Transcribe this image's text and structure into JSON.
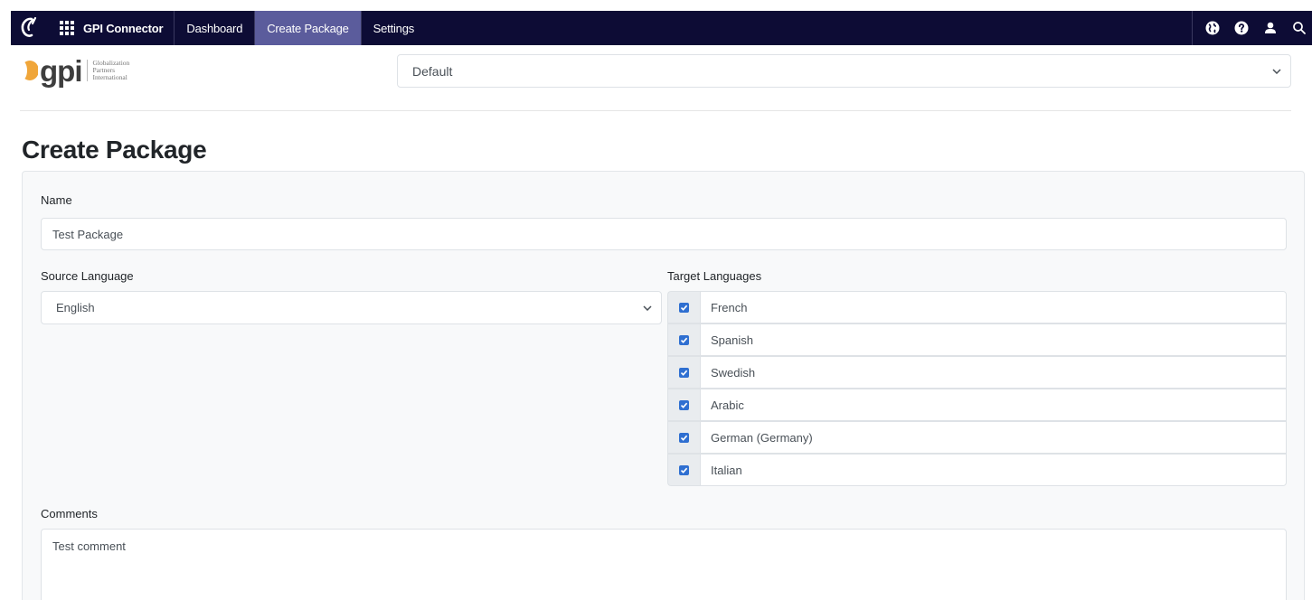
{
  "navbar": {
    "app_name": "GPI Connector",
    "items": [
      {
        "label": "Dashboard",
        "active": false
      },
      {
        "label": "Create Package",
        "active": true
      },
      {
        "label": "Settings",
        "active": false
      }
    ],
    "right_icons": [
      "globe-icon",
      "help-icon",
      "user-icon",
      "search-icon"
    ],
    "background_color": "#0d0c35",
    "active_color": "#5b5c9c"
  },
  "logo": {
    "text": "gpi",
    "subtitle_lines": [
      "Globalization",
      "Partners",
      "International"
    ]
  },
  "profile_select": {
    "value": "Default"
  },
  "page": {
    "title": "Create Package"
  },
  "form": {
    "name_label": "Name",
    "name_value": "Test Package",
    "source_label": "Source Language",
    "source_value": "English",
    "target_label": "Target Languages",
    "target_languages": [
      {
        "name": "French",
        "checked": true
      },
      {
        "name": "Spanish",
        "checked": true
      },
      {
        "name": "Swedish",
        "checked": true
      },
      {
        "name": "Arabic",
        "checked": true
      },
      {
        "name": "German (Germany)",
        "checked": true
      },
      {
        "name": "Italian",
        "checked": true
      }
    ],
    "comments_label": "Comments",
    "comments_value": "Test comment"
  }
}
